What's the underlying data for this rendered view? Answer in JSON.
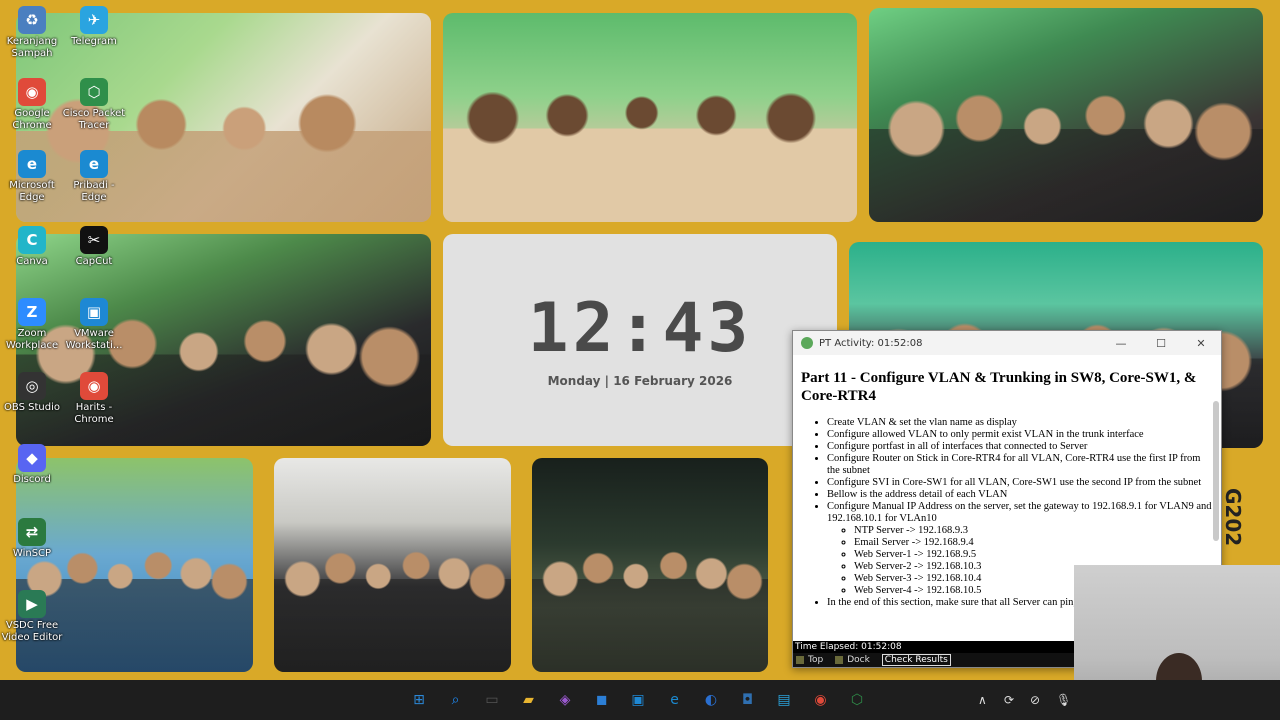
{
  "desktop": {
    "icons": [
      {
        "label": "Keranjang Sampah",
        "glyph": "♻",
        "color": "#4a7fc0",
        "icon": "recycle-bin-icon"
      },
      {
        "label": "Telegram",
        "glyph": "✈",
        "color": "#2aa4e0",
        "icon": "telegram-icon"
      },
      {
        "label": "Google Chrome",
        "glyph": "◉",
        "color": "#e04a3a",
        "icon": "chrome-icon"
      },
      {
        "label": "Cisco Packet Tracer",
        "glyph": "⬡",
        "color": "#2f8f4a",
        "icon": "packet-tracer-icon"
      },
      {
        "label": "Microsoft Edge",
        "glyph": "e",
        "color": "#1b8ad1",
        "icon": "edge-icon"
      },
      {
        "label": "Pribadi - Edge",
        "glyph": "e",
        "color": "#1b8ad1",
        "icon": "edge-profile-icon"
      },
      {
        "label": "Canva",
        "glyph": "C",
        "color": "#22b5c9",
        "icon": "canva-icon"
      },
      {
        "label": "CapCut",
        "glyph": "✂",
        "color": "#111111",
        "icon": "capcut-icon"
      },
      {
        "label": "Zoom Workplace",
        "glyph": "Z",
        "color": "#2d8cff",
        "icon": "zoom-icon"
      },
      {
        "label": "VMware Workstati...",
        "glyph": "▣",
        "color": "#1e88d4",
        "icon": "vmware-icon"
      },
      {
        "label": "OBS Studio",
        "glyph": "◎",
        "color": "#333333",
        "icon": "obs-icon"
      },
      {
        "label": "Harits - Chrome",
        "glyph": "◉",
        "color": "#e04a3a",
        "icon": "chrome-profile-icon"
      },
      {
        "label": "Discord",
        "glyph": "◆",
        "color": "#5865f2",
        "icon": "discord-icon"
      },
      {
        "label": "WinSCP",
        "glyph": "⇄",
        "color": "#2b7a3f",
        "icon": "winscp-icon"
      },
      {
        "label": "VSDC Free Video Editor",
        "glyph": "▶",
        "color": "#2a7a55",
        "icon": "vsdc-icon"
      }
    ]
  },
  "clock": {
    "time": "12:43",
    "date": "Monday | 16 February 2026"
  },
  "side_label": "G202",
  "activity": {
    "window_title": "PT Activity: 01:52:08",
    "minimize": "—",
    "maximize": "☐",
    "close": "✕",
    "heading": "Part 11 - Configure VLAN & Trunking in SW8, Core-SW1, & Core-RTR4",
    "tasks": [
      "Create VLAN & set the vlan name as display",
      "Configure allowed VLAN to only permit exist VLAN in the trunk interface",
      "Configure portfast in all of interfaces that connected to Server",
      "Configure Router on Stick in Core-RTR4 for all VLAN, Core-RTR4 use the first IP from the subnet",
      "Configure SVI in Core-SW1 for all VLAN, Core-SW1 use the second IP from the subnet",
      "Bellow is the address detail of each VLAN",
      "Configure Manual IP Address on the server, set the gateway to 192.168.9.1 for VLAN9 and 192.168.10.1 for VLAn10"
    ],
    "servers": [
      "NTP Server -> 192.168.9.3",
      "Email Server -> 192.168.9.4",
      "Web Server-1 -> 192.168.9.5",
      "Web Server-2 -> 192.168.10.3",
      "Web Server-3 -> 192.168.10.4",
      "Web Server-4 -> 192.168.10.5"
    ],
    "final_task": "In the end of this section, make sure that all Server can ping",
    "time_elapsed": "Time Elapsed: 01:52:08",
    "top_label": "Top",
    "dock_label": "Dock",
    "check_results": "Check Results"
  },
  "taskbar": {
    "apps": [
      {
        "glyph": "⊞",
        "color": "#2b88d8",
        "icon": "start-icon"
      },
      {
        "glyph": "⌕",
        "color": "#1e90ff",
        "icon": "search-icon"
      },
      {
        "glyph": "▭",
        "color": "#555555",
        "icon": "task-view-icon"
      },
      {
        "glyph": "▰",
        "color": "#e8b530",
        "icon": "file-explorer-icon"
      },
      {
        "glyph": "◈",
        "color": "#9b59d0",
        "icon": "copilot-icon"
      },
      {
        "glyph": "◼",
        "color": "#2c7fd6",
        "icon": "store-icon"
      },
      {
        "glyph": "▣",
        "color": "#1e88d4",
        "icon": "vmware-taskbar-icon"
      },
      {
        "glyph": "e",
        "color": "#1b8ad1",
        "icon": "edge-taskbar-icon"
      },
      {
        "glyph": "◐",
        "color": "#2a6fd0",
        "icon": "settings-taskbar-icon"
      },
      {
        "glyph": "◘",
        "color": "#2f6fb0",
        "icon": "app-taskbar-icon"
      },
      {
        "glyph": "▤",
        "color": "#2aa0d8",
        "icon": "notepad-icon"
      },
      {
        "glyph": "◉",
        "color": "#e04a3a",
        "icon": "chrome-taskbar-icon"
      },
      {
        "glyph": "⬡",
        "color": "#2f8f4a",
        "icon": "packet-tracer-taskbar-icon"
      }
    ],
    "tray": [
      {
        "glyph": "∧",
        "icon": "chevron-up-icon"
      },
      {
        "glyph": "⟳",
        "icon": "sync-icon"
      },
      {
        "glyph": "⊘",
        "icon": "network-icon"
      },
      {
        "glyph": "🎙",
        "icon": "microphone-icon"
      }
    ]
  }
}
